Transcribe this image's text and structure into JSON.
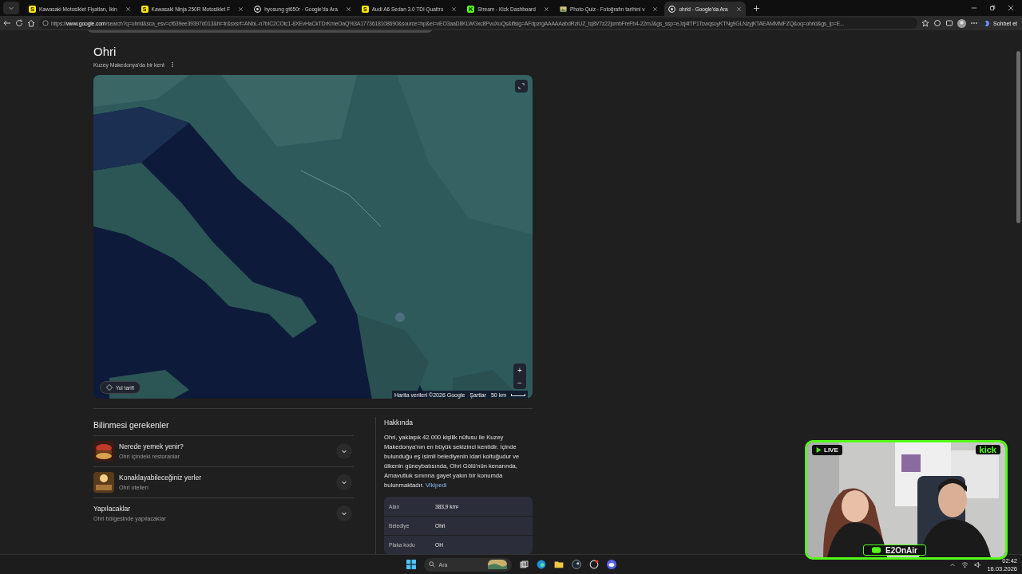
{
  "tabs": [
    {
      "title": "Kawasaki Motosiklet Fiyatları, İkin",
      "kind": "letter",
      "icon_text": "S",
      "selected": false
    },
    {
      "title": "Kawasaki Ninja 250R Motosiklet F",
      "kind": "letter",
      "icon_text": "S",
      "selected": false
    },
    {
      "title": "hyosung gt650r - Google'da Ara",
      "kind": "google",
      "selected": false
    },
    {
      "title": "Audi A6 Sedan 3.0 TDI Quattro",
      "kind": "letter",
      "icon_text": "S",
      "selected": false
    },
    {
      "title": "Stream - Kick Dashboard",
      "kind": "kick",
      "icon_text": "K",
      "selected": false
    },
    {
      "title": "Photo Quiz - Fotoğrafın tarihini v",
      "selected": false
    },
    {
      "title": "ohrid - Google'da Ara",
      "kind": "google",
      "selected": true
    }
  ],
  "address_bar": {
    "url": "https://**www.google.com**/search?q=ohrid&sca_esv=cf639ee39397d013&hl=tr&sxsrf=ANbL-n7bIC2COtc1-8XEvHaCkTDrKmeOaQ%3A1773618108690&source=hp&ei=vEO3aaD8KLWGxc8PvuXuQs&iflsig=AFdpzrgAAAAAabdRzIUZ_tq8V7z22jombFreFb4-22mJ&gs_ssp=eJzj4tTP1TcwqsoyKTNg9GLNzyjKTAEAMMMFZQ&oq=ohrid&gs_lp=E..."
  },
  "copilot_button": {
    "label": "Sohbet et"
  },
  "knowledge_panel": {
    "title": "Ohri",
    "subtitle": "Kuzey Makedonya'da bir kent",
    "map": {
      "kind": "picture",
      "directions_button": "Yol tarifi",
      "zoom_in": "+",
      "zoom_out": "−",
      "attribution": "Harita verileri ©2026 Google",
      "terms": "Şartlar",
      "scale": "50 km"
    },
    "things_to_know": {
      "heading": "Bilinmesi gerekenler",
      "items": [
        {
          "kind": "food",
          "title": "Nerede yemek yenir?",
          "subtitle": "Ohri içindeki restoranlar",
          "expanded": false
        },
        {
          "kind": "hotel",
          "title": "Konaklayabileceğiniz yerler",
          "subtitle": "Ohri otelleri",
          "expanded": false
        },
        {
          "kind": "plain",
          "title": "Yapılacaklar",
          "subtitle": "Ohri bölgesinde yapılacaklar",
          "expanded": false
        }
      ]
    },
    "about": {
      "heading": "Hakkında",
      "text": "Ohri, yaklaşık 42.000 kişilik nüfusu ile Kuzey Makedonya'nın en büyük sekizinci kentidir. İçinde bulunduğu eş isimli belediyenin idari koltuğudur ve ülkenin güneybatısında, Ohri Gölü'nün kenarında, Arnavutluk sınırına gayet yakın bir konumda bulunmaktadır.",
      "link": "Vikipedi",
      "facts": [
        {
          "label": "Alan",
          "value": "383,9 km²"
        },
        {
          "label": "Belediye",
          "value": "Ohri"
        },
        {
          "label": "Plaka kodu",
          "value": "OH"
        }
      ]
    }
  },
  "stream_overlay": {
    "live": "LIVE",
    "platform": "kick",
    "channel": "E2OnAir"
  },
  "taskbar": {
    "search_placeholder": "Ara",
    "time": "02:42",
    "date": "16.03.2026"
  }
}
